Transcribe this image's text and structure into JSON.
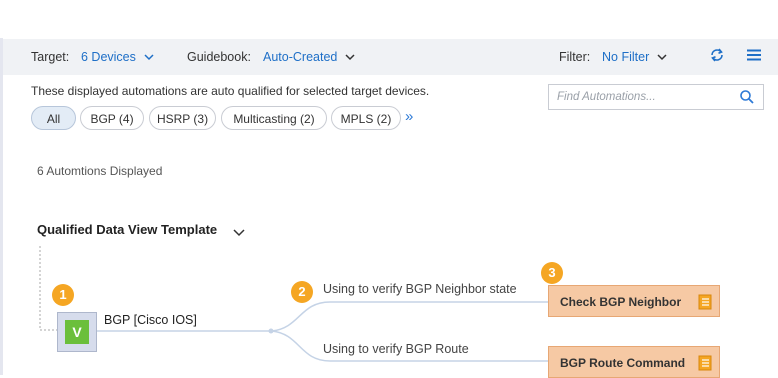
{
  "toolbar": {
    "target_label": "Target:",
    "target_value": "6 Devices",
    "guidebook_label": "Guidebook:",
    "guidebook_value": "Auto-Created",
    "filter_label": "Filter:",
    "filter_value": "No Filter",
    "refresh_icon": "refresh-icon",
    "menu_icon": "hamburger-menu-icon"
  },
  "description": "These displayed automations are auto qualified for selected target devices.",
  "chips": [
    {
      "label": "All",
      "active": true
    },
    {
      "label": "BGP (4)",
      "active": false
    },
    {
      "label": "HSRP (3)",
      "active": false
    },
    {
      "label": "Multicasting (2)",
      "active": false
    },
    {
      "label": "MPLS (2)",
      "active": false
    }
  ],
  "more_label": "»",
  "search": {
    "placeholder": "Find Automations..."
  },
  "count_text": "6 Automtions Displayed",
  "section": {
    "title": "Qualified Data View Template"
  },
  "node": {
    "badge": "1",
    "icon_letter": "V",
    "label": "BGP [Cisco IOS]"
  },
  "branches": [
    {
      "badge": "2",
      "label": "Using to verify BGP Neighbor state"
    },
    {
      "badge": null,
      "label": "Using to verify BGP Route"
    }
  ],
  "actions": [
    {
      "badge": "3",
      "label": "Check BGP Neighbor"
    },
    {
      "badge": null,
      "label": "BGP Route Command"
    }
  ],
  "colors": {
    "accent": "#1e6fc7",
    "badge": "#f5a623",
    "action_fill": "#f6c9a4",
    "node_icon": "#6bbf3b"
  }
}
